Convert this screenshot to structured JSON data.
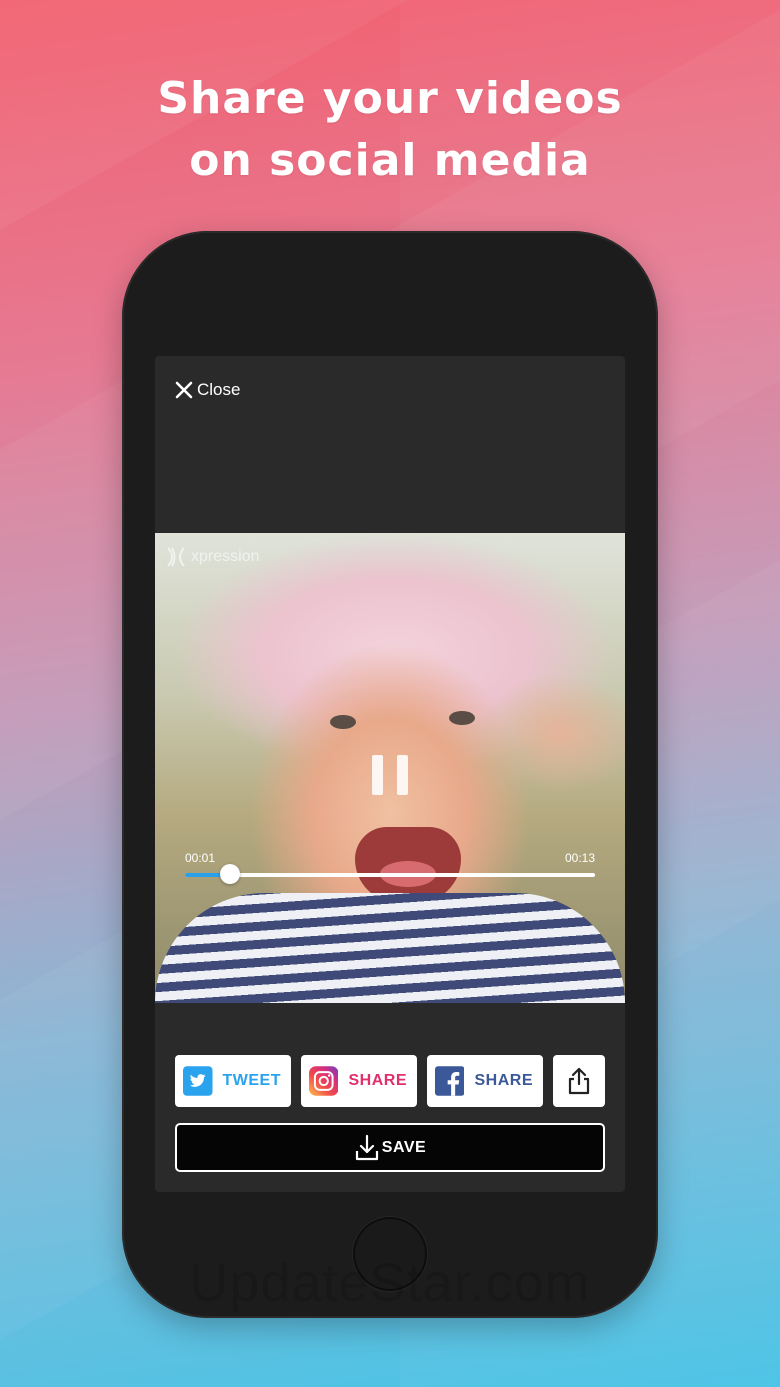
{
  "headline": {
    "line1": "Share your videos",
    "line2": "on social media"
  },
  "close_button": {
    "label": "Close",
    "icon": "close-icon"
  },
  "video": {
    "watermark_text": "xpression",
    "current_time": "00:01",
    "duration": "00:13",
    "progress_fraction": 0.11,
    "state": "playing"
  },
  "share": {
    "twitter": {
      "label": "TWEET",
      "color": "#2aa3ef",
      "icon": "twitter-bird-icon"
    },
    "instagram": {
      "label": "SHARE",
      "color": "#e1306c",
      "icon": "instagram-icon"
    },
    "facebook": {
      "label": "SHARE",
      "color": "#3b5998",
      "icon": "facebook-icon"
    },
    "generic": {
      "icon": "share-icon"
    }
  },
  "save_button": {
    "label": "SAVE",
    "icon": "download-icon"
  },
  "footer_watermark": "UpdateStar.com",
  "colors": {
    "progress_fill": "#2aa0ea",
    "screen_bg": "#2a2a2a",
    "phone_body": "#1c1c1c"
  }
}
